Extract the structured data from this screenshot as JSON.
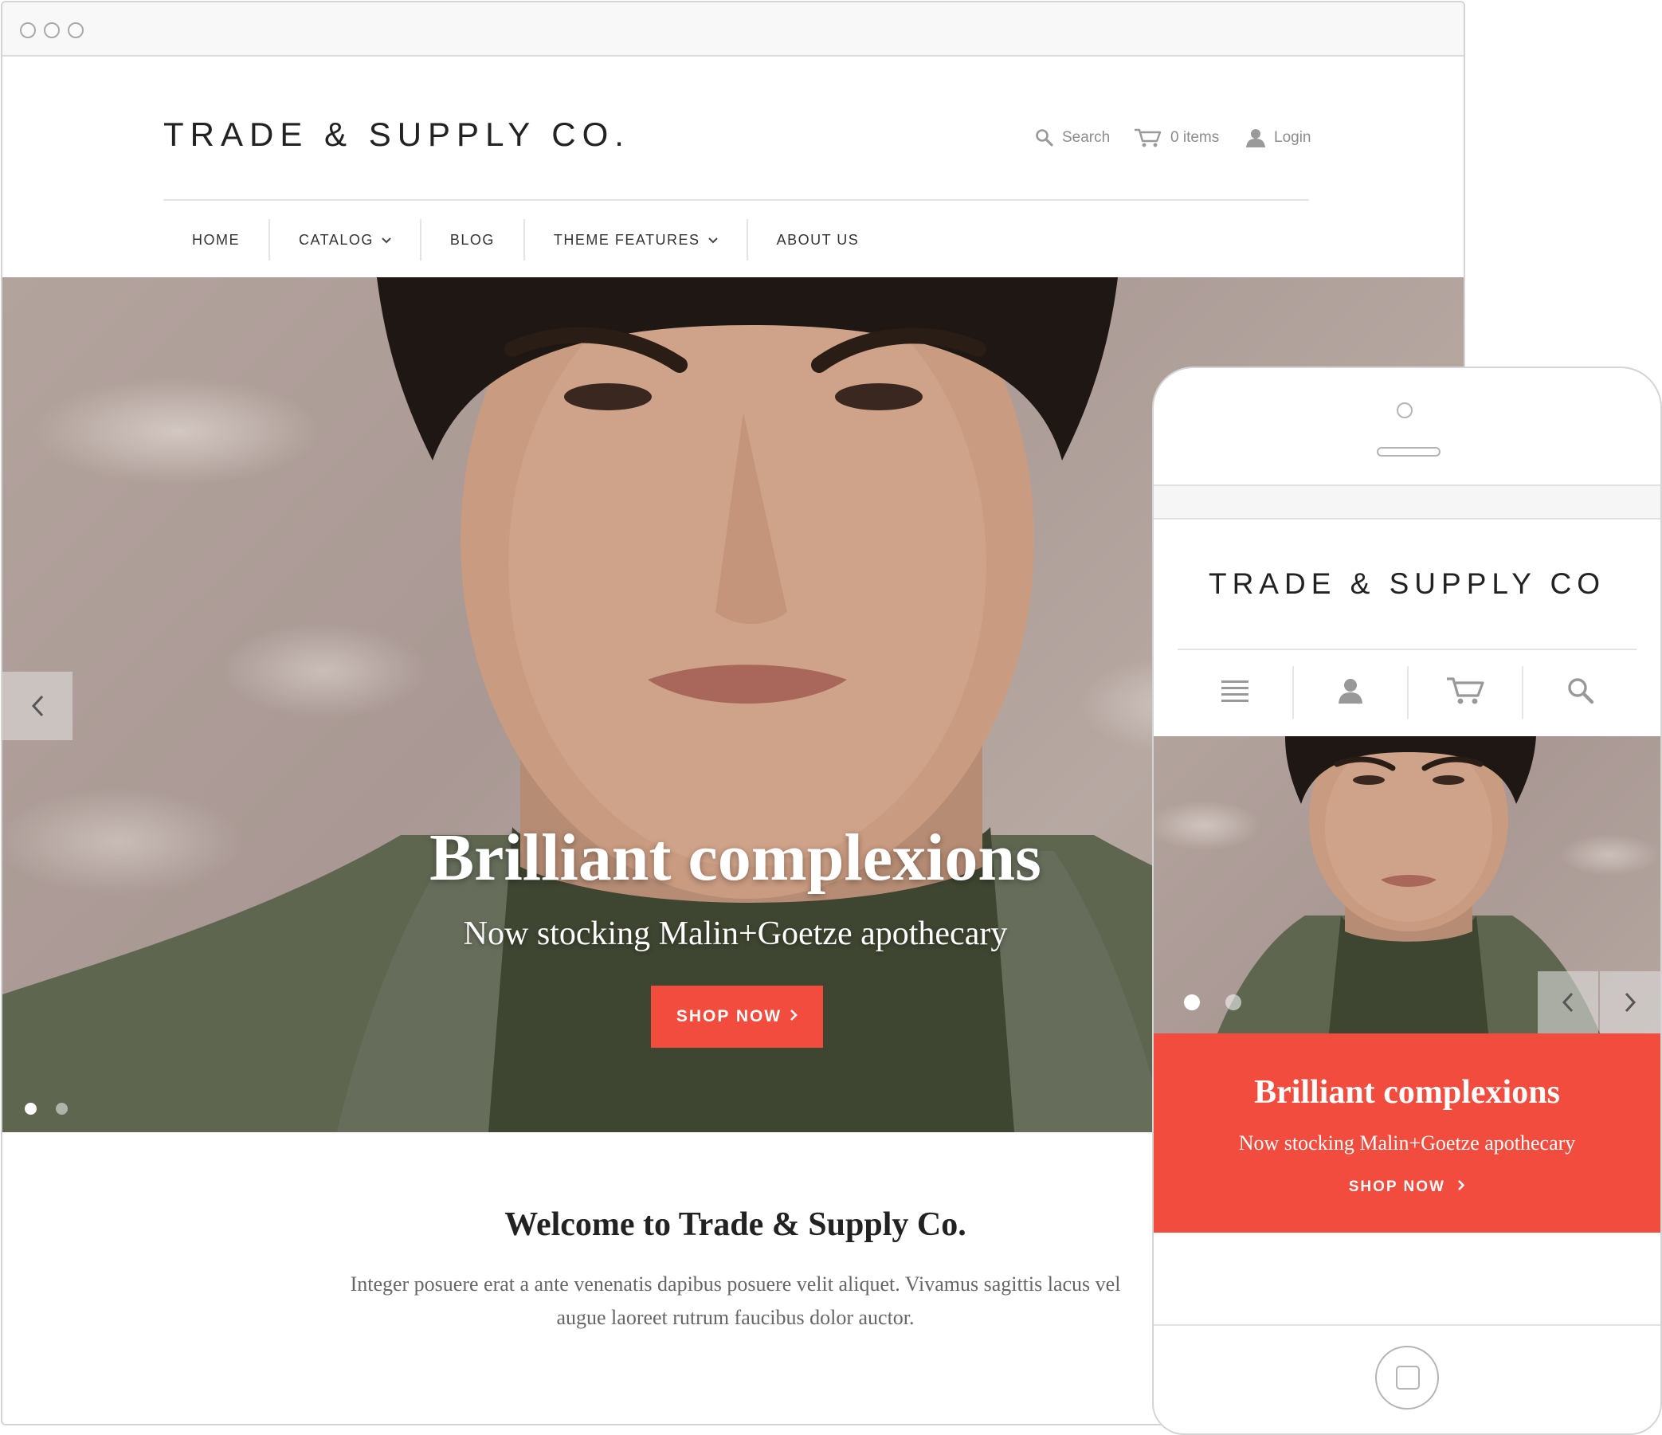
{
  "desktop": {
    "logo": "TRADE & SUPPLY CO.",
    "utility": {
      "search_label": "Search",
      "cart_label": "0 items",
      "login_label": "Login"
    },
    "nav": [
      {
        "label": "HOME",
        "has_dropdown": false
      },
      {
        "label": "CATALOG",
        "has_dropdown": true
      },
      {
        "label": "BLOG",
        "has_dropdown": false
      },
      {
        "label": "THEME FEATURES",
        "has_dropdown": true
      },
      {
        "label": "ABOUT US",
        "has_dropdown": false
      }
    ],
    "hero": {
      "title": "Brilliant complexions",
      "subtitle": "Now stocking Malin+Goetze apothecary",
      "button_label": "SHOP NOW",
      "button_color": "#f14c3d",
      "slide_count": 2,
      "active_slide": 1
    },
    "welcome": {
      "title": "Welcome to Trade & Supply Co.",
      "body": "Integer posuere erat a ante venenatis dapibus posuere velit aliquet. Vivamus sagittis lacus vel augue laoreet rutrum faucibus dolor auctor."
    }
  },
  "mobile": {
    "logo": "TRADE & SUPPLY CO",
    "toolbar_icons": [
      "menu-icon",
      "user-icon",
      "cart-icon",
      "search-icon"
    ],
    "hero": {
      "title": "Brilliant complexions",
      "subtitle": "Now stocking Malin+Goetze apothecary",
      "button_label": "SHOP NOW",
      "panel_color": "#f14c3d",
      "slide_count": 2,
      "active_slide": 1
    }
  },
  "icons": {
    "chevron_down": "⌄",
    "chevron_right": "›",
    "chevron_left": "‹"
  }
}
